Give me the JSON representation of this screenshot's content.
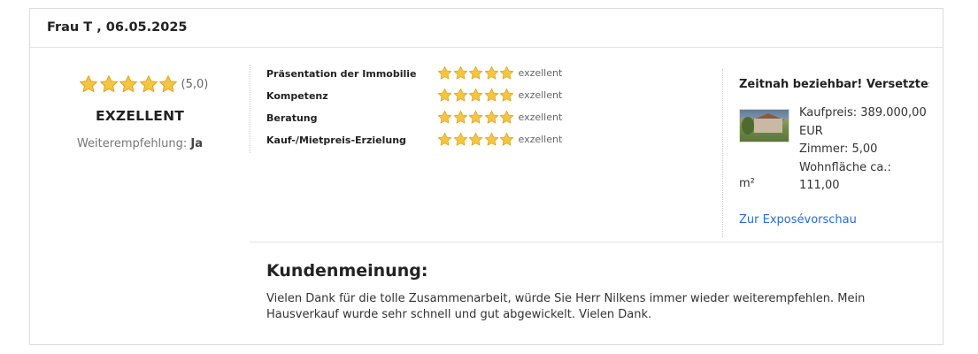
{
  "review": {
    "author_date": "Frau T , 06.05.2025",
    "overall": {
      "stars": 5,
      "max_stars": 5,
      "score_text": "(5,0)",
      "label": "EXZELLENT",
      "recommend_label": "Weiterempfehlung:",
      "recommend_value": "Ja"
    },
    "criteria": [
      {
        "label": "Präsentation der Immobilie",
        "stars": 5,
        "value": "exzellent"
      },
      {
        "label": "Kompetenz",
        "stars": 5,
        "value": "exzellent"
      },
      {
        "label": "Beratung",
        "stars": 5,
        "value": "exzellent"
      },
      {
        "label": "Kauf-/Mietpreis-Erzielung",
        "stars": 5,
        "value": "exzellent"
      }
    ],
    "property": {
      "title": "Zeitnah beziehbar! Versetztes R...",
      "price": "Kaufpreis: 389.000,00",
      "currency": "EUR",
      "rooms": "Zimmer: 5,00",
      "area": "Wohnfläche ca.: 111,00",
      "area_unit": "m²",
      "link_label": "Zur Exposévorschau"
    },
    "opinion": {
      "heading": "Kundenmeinung:",
      "text": "Vielen Dank für die tolle Zusammenarbeit, würde Sie Herr Nilkens immer wieder weiterempfehlen. Mein Hausverkauf wurde sehr schnell und gut abgewickelt. Vielen Dank."
    }
  },
  "colors": {
    "star_fill": "#f4c542",
    "star_stroke": "#d9a21b",
    "link": "#2b6bd3",
    "border": "#dcdcdc"
  },
  "icons": {
    "star": "star-icon",
    "property_thumb": "property-thumbnail"
  }
}
